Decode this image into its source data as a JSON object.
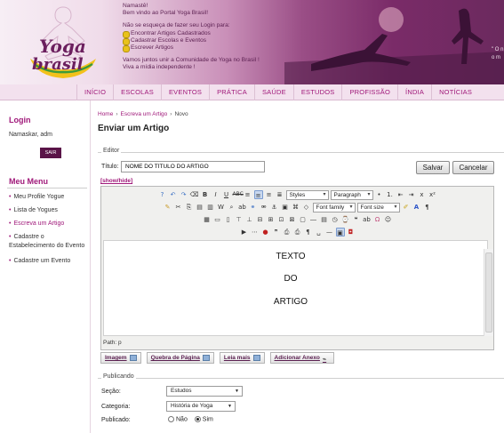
{
  "header": {
    "logo_text_top": "Yoga",
    "logo_text_bottom": "brasil",
    "welcome_lines": [
      "Namastê!",
      "Bem vindo ao Portal Yoga Brasil!"
    ],
    "login_note": "Não se esqueça de fazer seu Login para:",
    "login_items": [
      "Encontrar Artigos Cadastrados",
      "Cadastrar Escolas e Eventos",
      "Escrever Artigos"
    ],
    "community_lines": [
      "Vamos juntos unir a Comunidade de Yoga no Brasil !",
      "Viva a mídia independente !"
    ],
    "side_text_1": "\" O n",
    "side_text_2": "o m"
  },
  "nav": {
    "items": [
      "INÍCIO",
      "ESCOLAS",
      "EVENTOS",
      "PRÁTICA",
      "SAÚDE",
      "ESTUDOS",
      "PROFISSÃO",
      "ÍNDIA",
      "NOTÍCIAS"
    ]
  },
  "sidebar": {
    "login_title": "Login",
    "greeting": "Namaskar, adm",
    "logout_label": "SAIR",
    "menu_title": "Meu Menu",
    "menu_items": [
      "Meu Profile Yogue",
      "Lista de Yogues",
      "Escreva um Artigo",
      "Cadastre o Estabelecimento do Evento",
      "Cadastre um Evento"
    ]
  },
  "breadcrumb": [
    "Home",
    "Escreva um Artigo",
    "Novo"
  ],
  "page_title": "Enviar um Artigo",
  "editor_section": {
    "legend": "Editor",
    "title_label": "Título:",
    "title_value": "NOME DO TÍTULO DO ARTIGO",
    "save_label": "Salvar",
    "cancel_label": "Cancelar",
    "show_hide": "[show/hide]",
    "styles_select": "Styles",
    "paragraph_select": "Paragraph",
    "font_family_select": "Font family",
    "font_size_select": "Font size",
    "content_lines": [
      "TEXTO",
      "DO",
      "ARTIGO"
    ],
    "path": "Path: p"
  },
  "plugin_buttons": [
    "Imagem",
    "Quebra de Página",
    "Leia mais",
    "Adicionar Anexo"
  ],
  "publishing": {
    "legend": "Publicando",
    "section_label": "Seção:",
    "section_value": "Estudos",
    "category_label": "Categoria:",
    "category_value": "História de Yoga",
    "published_label": "Publicado:",
    "no_label": "Não",
    "yes_label": "Sim",
    "published_selected": "Sim"
  },
  "colors": {
    "brand": "#a0197a",
    "header_dark": "#6b2a5e",
    "nav_bg": "#f3e1ee"
  }
}
